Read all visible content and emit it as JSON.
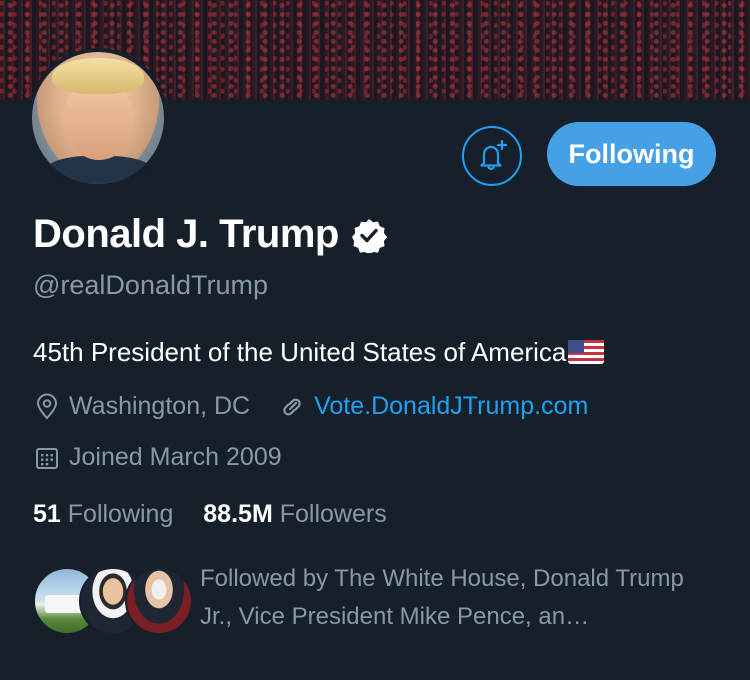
{
  "profile": {
    "name": "Donald J. Trump",
    "handle": "@realDonaldTrump",
    "bio": "45th President of the United States of America",
    "bio_emoji": "us-flag-emoji",
    "location": "Washington, DC",
    "website": "Vote.DonaldJTrump.com",
    "joined": "Joined March 2009",
    "verified": true
  },
  "actions": {
    "notify_icon": "bell-plus-icon",
    "follow_label": "Following"
  },
  "stats": {
    "following_count": "51",
    "following_label": "Following",
    "followers_count": "88.5M",
    "followers_label": "Followers"
  },
  "followed_by": {
    "text": "Followed by The White House, Donald Trump Jr., Vice President Mike Pence, an…"
  },
  "colors": {
    "background": "#15202b",
    "accent": "#1da1f2",
    "button": "#45a0e6",
    "muted": "#8899a6"
  }
}
